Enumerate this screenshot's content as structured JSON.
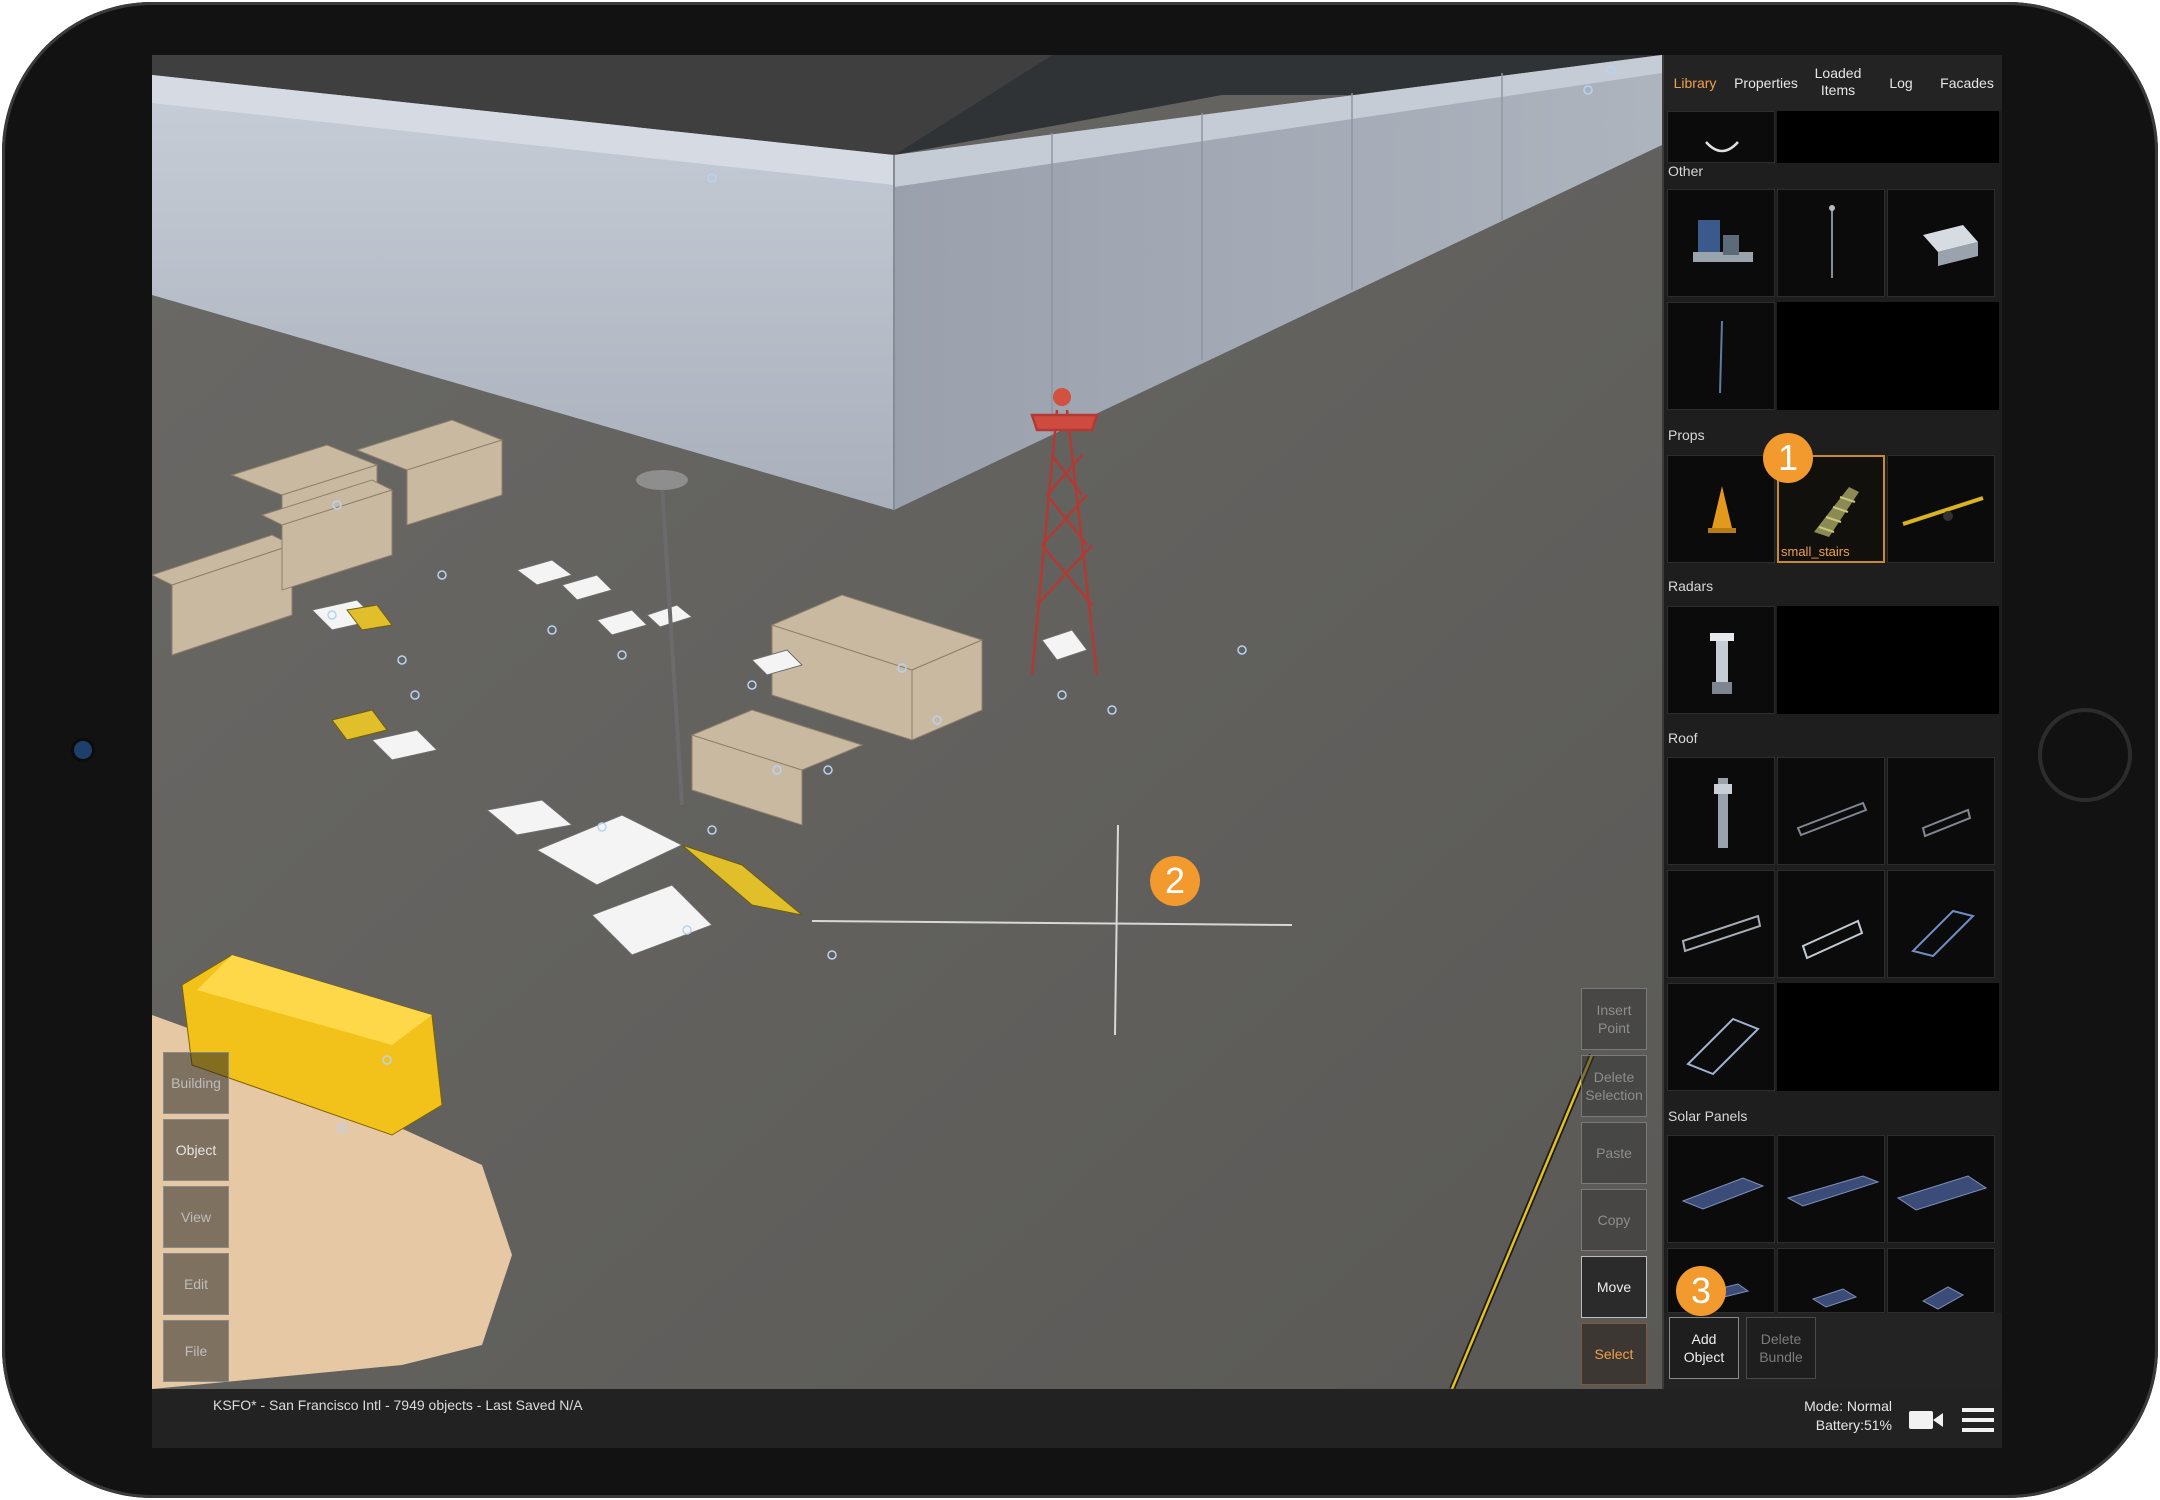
{
  "tabs": [
    {
      "label": "Library",
      "active": true
    },
    {
      "label": "Properties",
      "active": false
    },
    {
      "label": "Loaded Items",
      "active": false
    },
    {
      "label": "Log",
      "active": false
    },
    {
      "label": "Facades",
      "active": false
    }
  ],
  "library": {
    "sections": {
      "other": "Other",
      "props": "Props",
      "radars": "Radars",
      "roof": "Roof",
      "solar": "Solar Panels"
    },
    "selected_item": "small_stairs"
  },
  "tools": {
    "building": "Building",
    "object": "Object",
    "view": "View",
    "edit": "Edit",
    "file": "File"
  },
  "actions": {
    "insert_point": "Insert Point",
    "delete_selection": "Delete Selection",
    "paste": "Paste",
    "copy": "Copy",
    "move": "Move",
    "select": "Select"
  },
  "panel_buttons": {
    "add_object": "Add Object",
    "delete_bundle": "Delete Bundle"
  },
  "status": {
    "info": "KSFO* - San Francisco Intl - 7949 objects - Last Saved N/A",
    "mode": "Mode: Normal",
    "battery": "Battery:51%"
  },
  "callouts": [
    "1",
    "2",
    "3"
  ],
  "colors": {
    "accent": "#f0a04a",
    "callout": "#f29a2e",
    "panel_bg": "#1e1e1e"
  },
  "icons": [
    "video-camera-icon",
    "hamburger-menu-icon"
  ]
}
